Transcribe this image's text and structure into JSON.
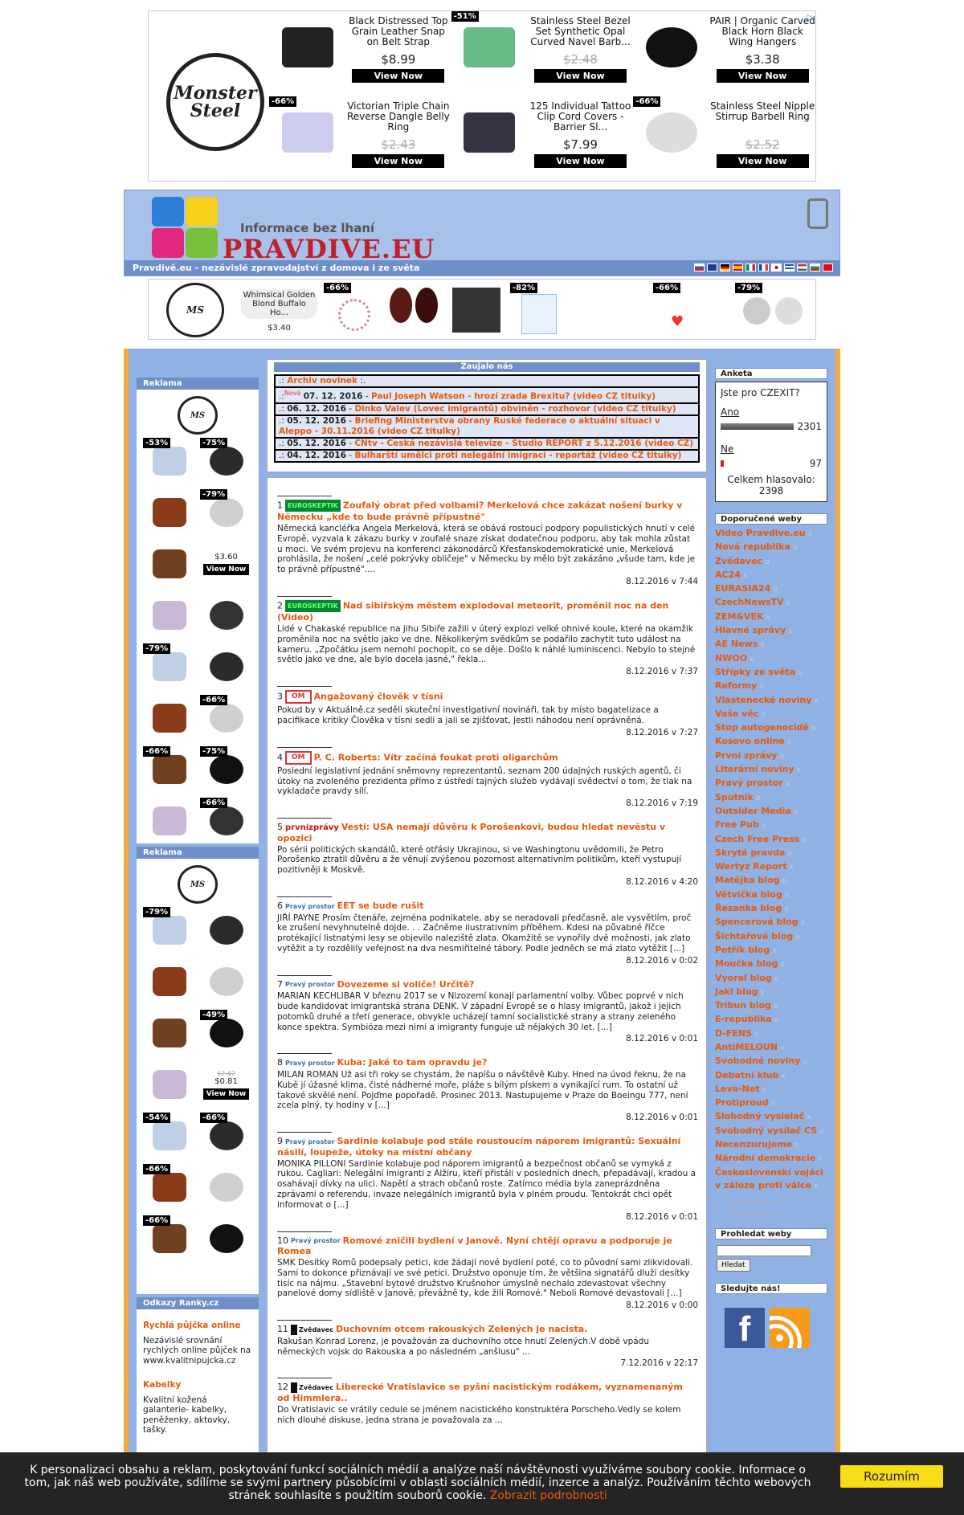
{
  "top_ad": {
    "logo": {
      "line1": "Monster",
      "line2": "Steel"
    },
    "items": [
      {
        "title": "Black Distressed Top Grain Leather Snap on Belt Strap",
        "price": "$8.99",
        "strike": false,
        "discount": "",
        "button": "View Now"
      },
      {
        "title": "Stainless Steel Bezel Set Synthetic Opal Curved Navel Barb...",
        "price": "$2.48",
        "strike": true,
        "discount": "-51%",
        "button": "View Now"
      },
      {
        "title": "PAIR | Organic Carved Black Horn Black Wing Hangers",
        "price": "$3.38",
        "strike": false,
        "discount": "",
        "button": "View Now"
      },
      {
        "title": "Victorian Triple Chain Reverse Dangle Belly Ring",
        "price": "$2.43",
        "strike": true,
        "discount": "-66%",
        "button": "View Now"
      },
      {
        "title": "125 Individual Tattoo Clip Cord Covers - Barrier Sl...",
        "price": "$7.99",
        "strike": false,
        "discount": "",
        "button": "View Now"
      },
      {
        "title": "Stainless Steel Nipple Stirrup Barbell Ring",
        "price": "$2.52",
        "strike": true,
        "discount": "-66%",
        "button": "View Now"
      }
    ]
  },
  "header": {
    "tagline": "Informace bez lhaní",
    "brand": "PRAVDIVE.EU",
    "subtitle": "Pravdivě.eu - nezávislé zpravodajství z domova i ze světa"
  },
  "strip_ad": {
    "item1_title": "Whimsical Golden Blond Buffalo Ho...",
    "item1_price": "$3.40",
    "discounts": [
      "-66%",
      "-82%",
      "-66%",
      "-79%"
    ]
  },
  "left": {
    "reklama1": "Reklama",
    "reklama2": "Reklama",
    "ad1_discounts": [
      "-53%",
      "-75%",
      "",
      "-79%",
      "",
      "",
      "",
      "",
      "-79%",
      "",
      "",
      "-66%",
      "-66%",
      "-75%",
      "",
      "-66%"
    ],
    "ad1_price": "$3.60",
    "ad1_button": "View Now",
    "ad2_discounts": [
      "-79%",
      "",
      "",
      "",
      "",
      "-49%",
      "",
      "",
      "-54%",
      "-66%",
      "-66%",
      "",
      "-66%",
      ""
    ],
    "ad2_price": "$0.81",
    "ad2_oldprice": "$2.42",
    "ad2_button": "View Now",
    "odkazy_head": "Odkazy Ranky.cz",
    "links": [
      {
        "title": "Rychlá půjčka online",
        "desc": "Nezávislé srovnání rychlých online půjček na www.kvalitnipujcka.cz"
      },
      {
        "title": "Kabelky",
        "desc": "Kvalitní kožená galanterie- kabelky, peněženky, aktovky, tašky."
      }
    ]
  },
  "zaujalo": {
    "head": "Zaujalo nás",
    "archive": "Archiv novinek",
    "nova": "Nová",
    "rows": [
      {
        "date": "07. 12. 2016",
        "title": "Paul Joseph Watson - hrozí zrada Brexitu? (video CZ titulky)"
      },
      {
        "date": "06. 12. 2016",
        "title": "Dinko Valev (Lovec imigrantů) obviněn - rozhovor (video CZ titulky)"
      },
      {
        "date": "05. 12. 2016",
        "title": "Briefing Ministerstva obrany Ruské federace o aktuální situaci v Aleppo - 30.11.2016 (video CZ titulky)"
      },
      {
        "date": "05. 12. 2016",
        "title": "CNtv - Česká nezávislá televize - Studio REPORT z 5.12.2016 (video CZ)"
      },
      {
        "date": "04. 12. 2016",
        "title": "Bulharští umělci proti nelegální imigraci - reportáž (video CZ titulky)"
      }
    ]
  },
  "articles": [
    {
      "num": "1",
      "src": "EUROSKEPTIK",
      "title": "Zoufalý obrat před volbami? Merkelová chce zakázat nošení burky v Německu „kde to bude právně přípustné\"",
      "body": "Německá kancléřka Angela Merkelová, která se obává rostoucí podpory populistických hnutí v celé Evropě, vyzvala k zákazu burky v zoufalé snaze získat dodatečnou podporu, aby tak mohla zůstat u moci.   Ve svém projevu na konferenci zákonodárců Křesťanskodemokratické unie, Merkelová prohlásila, že nošení „celé pokrývky obličeje\" v Německu by mělo být zakázáno „všude tam, kde je to právně přípustné\"....",
      "date": "8.12.2016 v 7:44"
    },
    {
      "num": "2",
      "src": "EUROSKEPTIK",
      "title": "Nad sibiřským městem explodoval meteorit, proměnil noc na den (Video)",
      "body": "Lidé v Chakaské republice na jihu Sibiře zažili v úterý explozi velké ohnivé koule, které na okamžik proměnila noc na světlo jako ve dne. Několikerým svědkům se podařilo zachytit tuto událost na kameru.   „Zpočátku jsem nemohl pochopit, co se děje. Došlo k náhlé luminiscenci. Nebylo to stejné světlo jako ve dne, ale bylo docela jasné,\" řekla...",
      "date": "8.12.2016 v 7:37"
    },
    {
      "num": "3",
      "src": "OM",
      "title": "Angažovaný člověk v tísni",
      "body": "Pokud by v Aktuálně.cz seděli skuteční investigativní novináři, tak by místo bagatelizace a pacifikace kritiky Člověka v tísni sedli a jali se zjišťovat, jestli náhodou není oprávněná.",
      "date": "8.12.2016 v 7:27"
    },
    {
      "num": "4",
      "src": "OM",
      "title": "P. C. Roberts: Vítr začíná foukat proti oligarchům",
      "body": "Poslední legislativní jednání sněmovny reprezentantů, seznam 200 údajných ruských agentů, či útoky na zvoleného prezidenta přímo z ústředí tajných služeb vydávají svědectví o tom, že tlak na vykladače pravdy sílí.",
      "date": "8.12.2016 v 7:19"
    },
    {
      "num": "5",
      "src": "prvnízprávy",
      "title": "Vesti: USA nemají důvěru k Porošenkovi, budou hledat nevěstu v opozici",
      "body": "Po sérii politických skandálů, které otřásly Ukrajinou, si ve Washingtonu uvědomili, že Petro Porošenko ztratil důvěru a že věnují zvýšenou pozornost alternativním politikům, kteří vystupují pozitivněji k Moskvě.",
      "date": "8.12.2016 v 4:20"
    },
    {
      "num": "6",
      "src": "Pravý prostor",
      "title": "EET se bude rušit",
      "body": "JIŘÍ PAYNE Prosím čtenáře, zejména podnikatele, aby se neradovali předčasně, ale vysvětlím, proč ke zrušení nevyhnutelně dojde.  .  . Začněme ilustrativním příběhem. Kdesi na půvabné říčce protékající listnatými lesy se objevilo naleziště zlata. Okamžitě se vynořily dvě možnosti, jak zlato vytěžit a ty rozdělily veřejnost na dva nesmiřitelné tábory. Podle jedněch se má zlato vytěžit [...]",
      "date": "8.12.2016 v 0:02"
    },
    {
      "num": "7",
      "src": "Pravý prostor",
      "title": "Dovezeme si voliče! Určitě?",
      "body": "MARIAN KECHLIBAR V březnu 2017 se v Nizozemí konají parlamentní volby. Vůbec poprvé v nich bude kandidovat imigrantská strana DENK. V západní Evropě se o hlasy imigrantů, jakož i jejich potomků druhé a třetí generace, obvykle ucházejí tamní socialistické strany a strany zeleného konce spektra. Symbióza mezi nimi a imigranty funguje už nějakých 30 let. [...]",
      "date": "8.12.2016 v 0:01"
    },
    {
      "num": "8",
      "src": "Pravý prostor",
      "title": "Kuba: Jaké to tam opravdu je?",
      "body": "MILAN ROMAN Už asi tři roky se chystám, že napíšu o návštěvě Kuby. Hned na úvod řeknu, že na Kubě jí úžasné klima, čisté nádherné moře, pláže s bílým pískem a vynikající rum. To ostatní už takové skvělé není. Pojďme popořadě. Prosinec 2013. Nastupujeme v Praze do Boeingu 777, není zcela plný, ty hodiny v [...]",
      "date": "8.12.2016 v 0:01"
    },
    {
      "num": "9",
      "src": "Pravý prostor",
      "title": "Sardinie kolabuje pod stále roustoucím náporem imigrantů: Sexuální násilí, loupeže, útoky na místní občany",
      "body": "MONIKA PILLONI Sardinie kolabuje pod náporem imigrantů a bezpečnost občanů se vymyká z rukou. Cagliari: Nelegální imigranti z Alžíru, kteří přistáli v posledních dnech, přepadávají, kradou a osahávají dívky na ulici. Napětí a strach občanů roste. Zatímco média byla zaneprázdněna zprávami o referendu, invaze nelegálních imigrantů byla v plném proudu. Tentokrát chci opět informovat o [...]",
      "date": "8.12.2016 v 0:01"
    },
    {
      "num": "10",
      "src": "Pravý prostor",
      "title": "Romové zničili bydlení v Janově. Nyní chtějí opravu a podporuje je Romea",
      "body": "SMK Desítky Romů podepsaly petici, kde žádají nové bydlení poté, co to původní sami zlikvidovali. Sami to dokonce přiznávají ve své petici. Družstvo oponuje tím, že většina signatářů dluží desítky tisíc na nájmu. „Stavební bytové družstvo Krušnohor úmyslně nechalo zdevastovat všechny panelové domy sídliště v Janově, převážně ty, kde žili Romové.\" Neboli Romové devastovali [...]",
      "date": "8.12.2016 v 0:00"
    },
    {
      "num": "11",
      "src": "Zvědavec",
      "title": "Duchovním otcem rakouských Zelených je nacista.",
      "body": "Rakušan Konrad Lorenz, je považován za duchovního otce hnutí Zelených.V době vpádu německých vojsk do Rakouska a po následném „anšlusu\" ...",
      "date": "7.12.2016 v 22:17"
    },
    {
      "num": "12",
      "src": "Zvědavec",
      "title": "Liberecké Vratislavice se pyšní nacistickým rodákem, vyznamenaným od Himmlera..",
      "body": "Do Vratislavic se vrátily cedule se jménem nacistického konstruktéra Porscheho.Vedly se kolem nich dlouhé diskuse, jedna strana je považovala za ...",
      "date": ""
    }
  ],
  "anketa": {
    "head": "Anketa",
    "question": "Jste pro CZEXIT?",
    "yes_label": "Ano",
    "yes_count": "2301",
    "no_label": "Ne",
    "no_count": "97",
    "total_label": "Celkem hlasovalo:",
    "total": "2398"
  },
  "doporucene": {
    "head": "Doporučené weby",
    "items": [
      "Video Pravdive.eu",
      "Nová republika",
      "Zvědavec",
      "AC24",
      "EURASIA24",
      "CzechNewsTV",
      "ZEM&VEK",
      "Hlavné správy",
      "AE News",
      "NWOO",
      "Střípky ze světa",
      "Reformy",
      "Vlastenecké noviny",
      "Vaše věc",
      "Stop autogenocidě",
      "Kosovo online",
      "První zprávy",
      "Literární noviny",
      "Pravý prostor",
      "Sputnik",
      "Outsider Media",
      "Free Pub",
      "Czech Free Press",
      "Skrytá pravda",
      "Wertyz Report",
      "Matějka blog",
      "Větvička blog",
      "Řezanka blog",
      "Spencerová blog",
      "Šichtařová blog",
      "Petřík blog",
      "Moučka blog",
      "Vyoral blog",
      "Jakl blog",
      "Tribun blog",
      "E-republika",
      "D-FENS",
      "AntiMELOUN",
      "Svobodné noviny",
      "Debatní klub",
      "Leva-Net",
      "Protiproud",
      "Slobodný vysielač",
      "Svobodný vysílač CS",
      "Necenzurujeme",
      "Národní demokracie",
      "Československí vojáci v záloze proti válce"
    ],
    "legend1": "o - odebíráme (40)",
    "legend2": "x - neodebíráme"
  },
  "search": {
    "head": "Prohledat weby",
    "button": "Hledat"
  },
  "follow": {
    "head": "Sledujte nás!"
  },
  "cookie": {
    "text": "K personalizaci obsahu a reklam, poskytování funkcí sociálních médií a analýze naší návštěvnosti využíváme soubory cookie. Informace o tom, jak náš web používáte, sdílíme se svými partnery působícími v oblasti sociálních médií, inzerce a analýz. Používáním těchto webových stránek souhlasíte s použitím souborů cookie.",
    "link": "Zobrazit podrobnosti",
    "button": "Rozumím"
  },
  "colors": {
    "accent": "#e8590c",
    "header_bg": "#a7c1ea",
    "frame_border": "#f3a93c",
    "side_head": "#6e8fc7"
  }
}
